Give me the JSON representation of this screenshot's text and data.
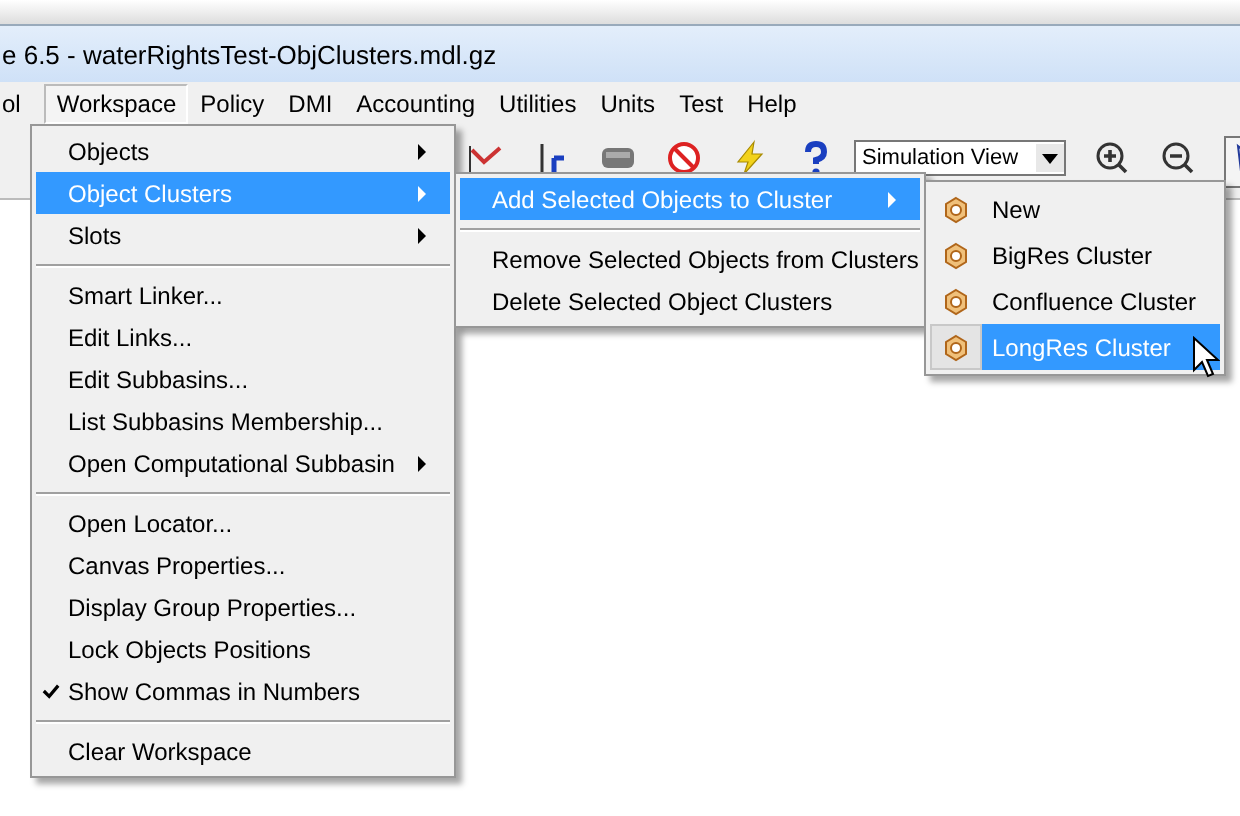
{
  "window": {
    "title": "e 6.5 - waterRightsTest-ObjClusters.mdl.gz"
  },
  "menubar": [
    {
      "label": "ol",
      "selected": false
    },
    {
      "label": "Workspace",
      "selected": true
    },
    {
      "label": "Policy",
      "selected": false
    },
    {
      "label": "DMI",
      "selected": false
    },
    {
      "label": "Accounting",
      "selected": false
    },
    {
      "label": "Utilities",
      "selected": false
    },
    {
      "label": "Units",
      "selected": false
    },
    {
      "label": "Test",
      "selected": false
    },
    {
      "label": "Help",
      "selected": false
    }
  ],
  "toolbar": {
    "view_select": "Simulation View"
  },
  "workspace_menu": {
    "items": [
      {
        "kind": "item",
        "label": "Objects",
        "submenu": true,
        "checked": false,
        "selected": false
      },
      {
        "kind": "item",
        "label": "Object Clusters",
        "submenu": true,
        "checked": false,
        "selected": true
      },
      {
        "kind": "item",
        "label": "Slots",
        "submenu": true,
        "checked": false,
        "selected": false
      },
      {
        "kind": "separator"
      },
      {
        "kind": "item",
        "label": "Smart Linker...",
        "submenu": false,
        "checked": false,
        "selected": false
      },
      {
        "kind": "item",
        "label": "Edit Links...",
        "submenu": false,
        "checked": false,
        "selected": false
      },
      {
        "kind": "item",
        "label": "Edit Subbasins...",
        "submenu": false,
        "checked": false,
        "selected": false
      },
      {
        "kind": "item",
        "label": "List Subbasins Membership...",
        "submenu": false,
        "checked": false,
        "selected": false
      },
      {
        "kind": "item",
        "label": "Open Computational Subbasin",
        "submenu": true,
        "checked": false,
        "selected": false
      },
      {
        "kind": "separator"
      },
      {
        "kind": "item",
        "label": "Open Locator...",
        "submenu": false,
        "checked": false,
        "selected": false
      },
      {
        "kind": "item",
        "label": "Canvas Properties...",
        "submenu": false,
        "checked": false,
        "selected": false
      },
      {
        "kind": "item",
        "label": "Display Group Properties...",
        "submenu": false,
        "checked": false,
        "selected": false
      },
      {
        "kind": "item",
        "label": "Lock Objects Positions",
        "submenu": false,
        "checked": false,
        "selected": false
      },
      {
        "kind": "item",
        "label": "Show Commas in Numbers",
        "submenu": false,
        "checked": true,
        "selected": false
      },
      {
        "kind": "separator"
      },
      {
        "kind": "item",
        "label": "Clear Workspace",
        "submenu": false,
        "checked": false,
        "selected": false
      }
    ]
  },
  "clusters_submenu": {
    "items": [
      {
        "kind": "item",
        "label": "Add Selected Objects to Cluster",
        "submenu": true,
        "selected": true
      },
      {
        "kind": "separator"
      },
      {
        "kind": "item",
        "label": "Remove Selected Objects from Clusters",
        "submenu": false,
        "selected": false
      },
      {
        "kind": "item",
        "label": "Delete Selected Object Clusters",
        "submenu": false,
        "selected": false
      }
    ]
  },
  "add_submenu": {
    "items": [
      {
        "label": "New",
        "selected": false
      },
      {
        "label": "BigRes Cluster",
        "selected": false
      },
      {
        "label": "Confluence Cluster",
        "selected": false
      },
      {
        "label": "LongRes Cluster",
        "selected": true
      }
    ]
  }
}
